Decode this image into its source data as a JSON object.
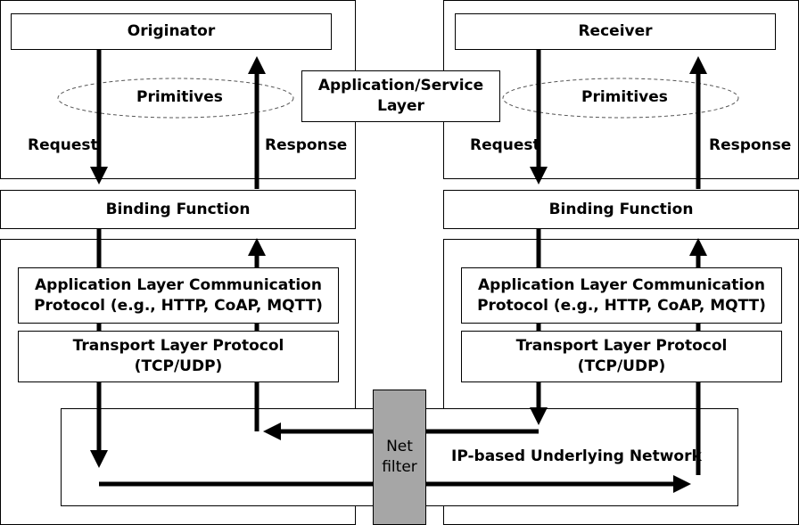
{
  "left": {
    "top_box": "Originator",
    "primitives": "Primitives",
    "request": "Request",
    "response": "Response",
    "binding": "Binding Function",
    "app_protocol_line1": "Application Layer Communication",
    "app_protocol_line2": "Protocol (e.g., HTTP, CoAP, MQTT)",
    "transport_line1": "Transport Layer Protocol",
    "transport_line2": "(TCP/UDP)"
  },
  "right": {
    "top_box": "Receiver",
    "primitives": "Primitives",
    "request": "Request",
    "response": "Response",
    "binding": "Binding Function",
    "app_protocol_line1": "Application Layer Communication",
    "app_protocol_line2": "Protocol (e.g., HTTP, CoAP, MQTT)",
    "transport_line1": "Transport Layer Protocol",
    "transport_line2": "(TCP/UDP)"
  },
  "center": {
    "service_layer_line1": "Application/Service",
    "service_layer_line2": "Layer",
    "net_filter_line1": "Net",
    "net_filter_line2": "filter",
    "network": "IP-based Underlying Network"
  },
  "colors": {
    "net_filter": "#a6a6a6"
  }
}
